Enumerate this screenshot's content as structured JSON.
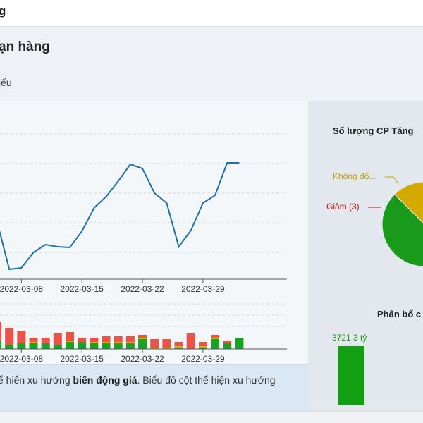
{
  "app": {
    "title": "g"
  },
  "header": {
    "title": "ạn hàng",
    "tab": "iểu"
  },
  "note": {
    "prefix": "ể hiển xu hướng ",
    "bold": "biến động giá",
    "suffix": ". Biểu đồ cột thể hiện xu hướng"
  },
  "colors": {
    "line": "#1f6fa8",
    "up": "#19a12a",
    "down": "#e8534a",
    "flat": "#d4b200",
    "pie_green": "#1a9a1a",
    "pie_red": "#b01818",
    "pie_yellow": "#d4aa00"
  },
  "pie": {
    "title": "Số lượng CP Tăng",
    "label_flat": "Không đổ...",
    "label_down": "Giảm (3)"
  },
  "distribution": {
    "title": "Phân bổ c",
    "value_label": "3721.3 tỷ"
  },
  "chart_data": [
    {
      "type": "line",
      "x": [
        "2022-03-04",
        "2022-03-07",
        "2022-03-08",
        "2022-03-09",
        "2022-03-10",
        "2022-03-11",
        "2022-03-14",
        "2022-03-15",
        "2022-03-16",
        "2022-03-17",
        "2022-03-18",
        "2022-03-21",
        "2022-03-22",
        "2022-03-23",
        "2022-03-24",
        "2022-03-25",
        "2022-03-28",
        "2022-03-29",
        "2022-03-30",
        "2022-03-31",
        "2022-04-01"
      ],
      "y": [
        315,
        382,
        380,
        358,
        347,
        350,
        351,
        328,
        295,
        279,
        257,
        233,
        239,
        274,
        288,
        350,
        327,
        288,
        277,
        231,
        231
      ],
      "xticks": [
        "2022-03-08",
        "2022-03-15",
        "2022-03-22",
        "2022-03-29"
      ],
      "grid": true
    },
    {
      "type": "bar",
      "x": [
        "2022-03-04",
        "2022-03-07",
        "2022-03-08",
        "2022-03-09",
        "2022-03-10",
        "2022-03-11",
        "2022-03-14",
        "2022-03-15",
        "2022-03-16",
        "2022-03-17",
        "2022-03-18",
        "2022-03-21",
        "2022-03-22",
        "2022-03-23",
        "2022-03-24",
        "2022-03-25",
        "2022-03-28",
        "2022-03-29",
        "2022-03-30",
        "2022-03-31",
        "2022-04-01"
      ],
      "series": [
        {
          "values": [
            6,
            3,
            4,
            4,
            4,
            3,
            5,
            5,
            4,
            4,
            4,
            4,
            7,
            0,
            0,
            1,
            0,
            1,
            7,
            4,
            8
          ]
        },
        {
          "values": [
            0,
            0,
            0,
            1,
            0,
            0,
            1,
            0,
            1,
            1,
            1,
            1,
            1,
            1,
            1,
            1,
            0,
            1,
            1,
            0,
            0
          ]
        },
        {
          "values": [
            13,
            12,
            9,
            3,
            4,
            8,
            6,
            3,
            3,
            4,
            4,
            4,
            2,
            6,
            6,
            3,
            11,
            3,
            2,
            2,
            0
          ]
        }
      ],
      "xticks": [
        "2022-03-08",
        "2022-03-15",
        "2022-03-22",
        "2022-03-29"
      ],
      "grid": true
    },
    {
      "type": "pie",
      "title": "Số lượng CP Tăng",
      "slices": [
        {
          "label": "Không đổ...",
          "value": 1
        },
        {
          "label": "Giảm (3)",
          "value": 0.35
        },
        {
          "label": "",
          "value": 2
        }
      ]
    },
    {
      "type": "bar",
      "title": "Phân bổ c",
      "values": [
        3721.3
      ],
      "labels": [
        "3721.3 tỷ"
      ]
    }
  ]
}
